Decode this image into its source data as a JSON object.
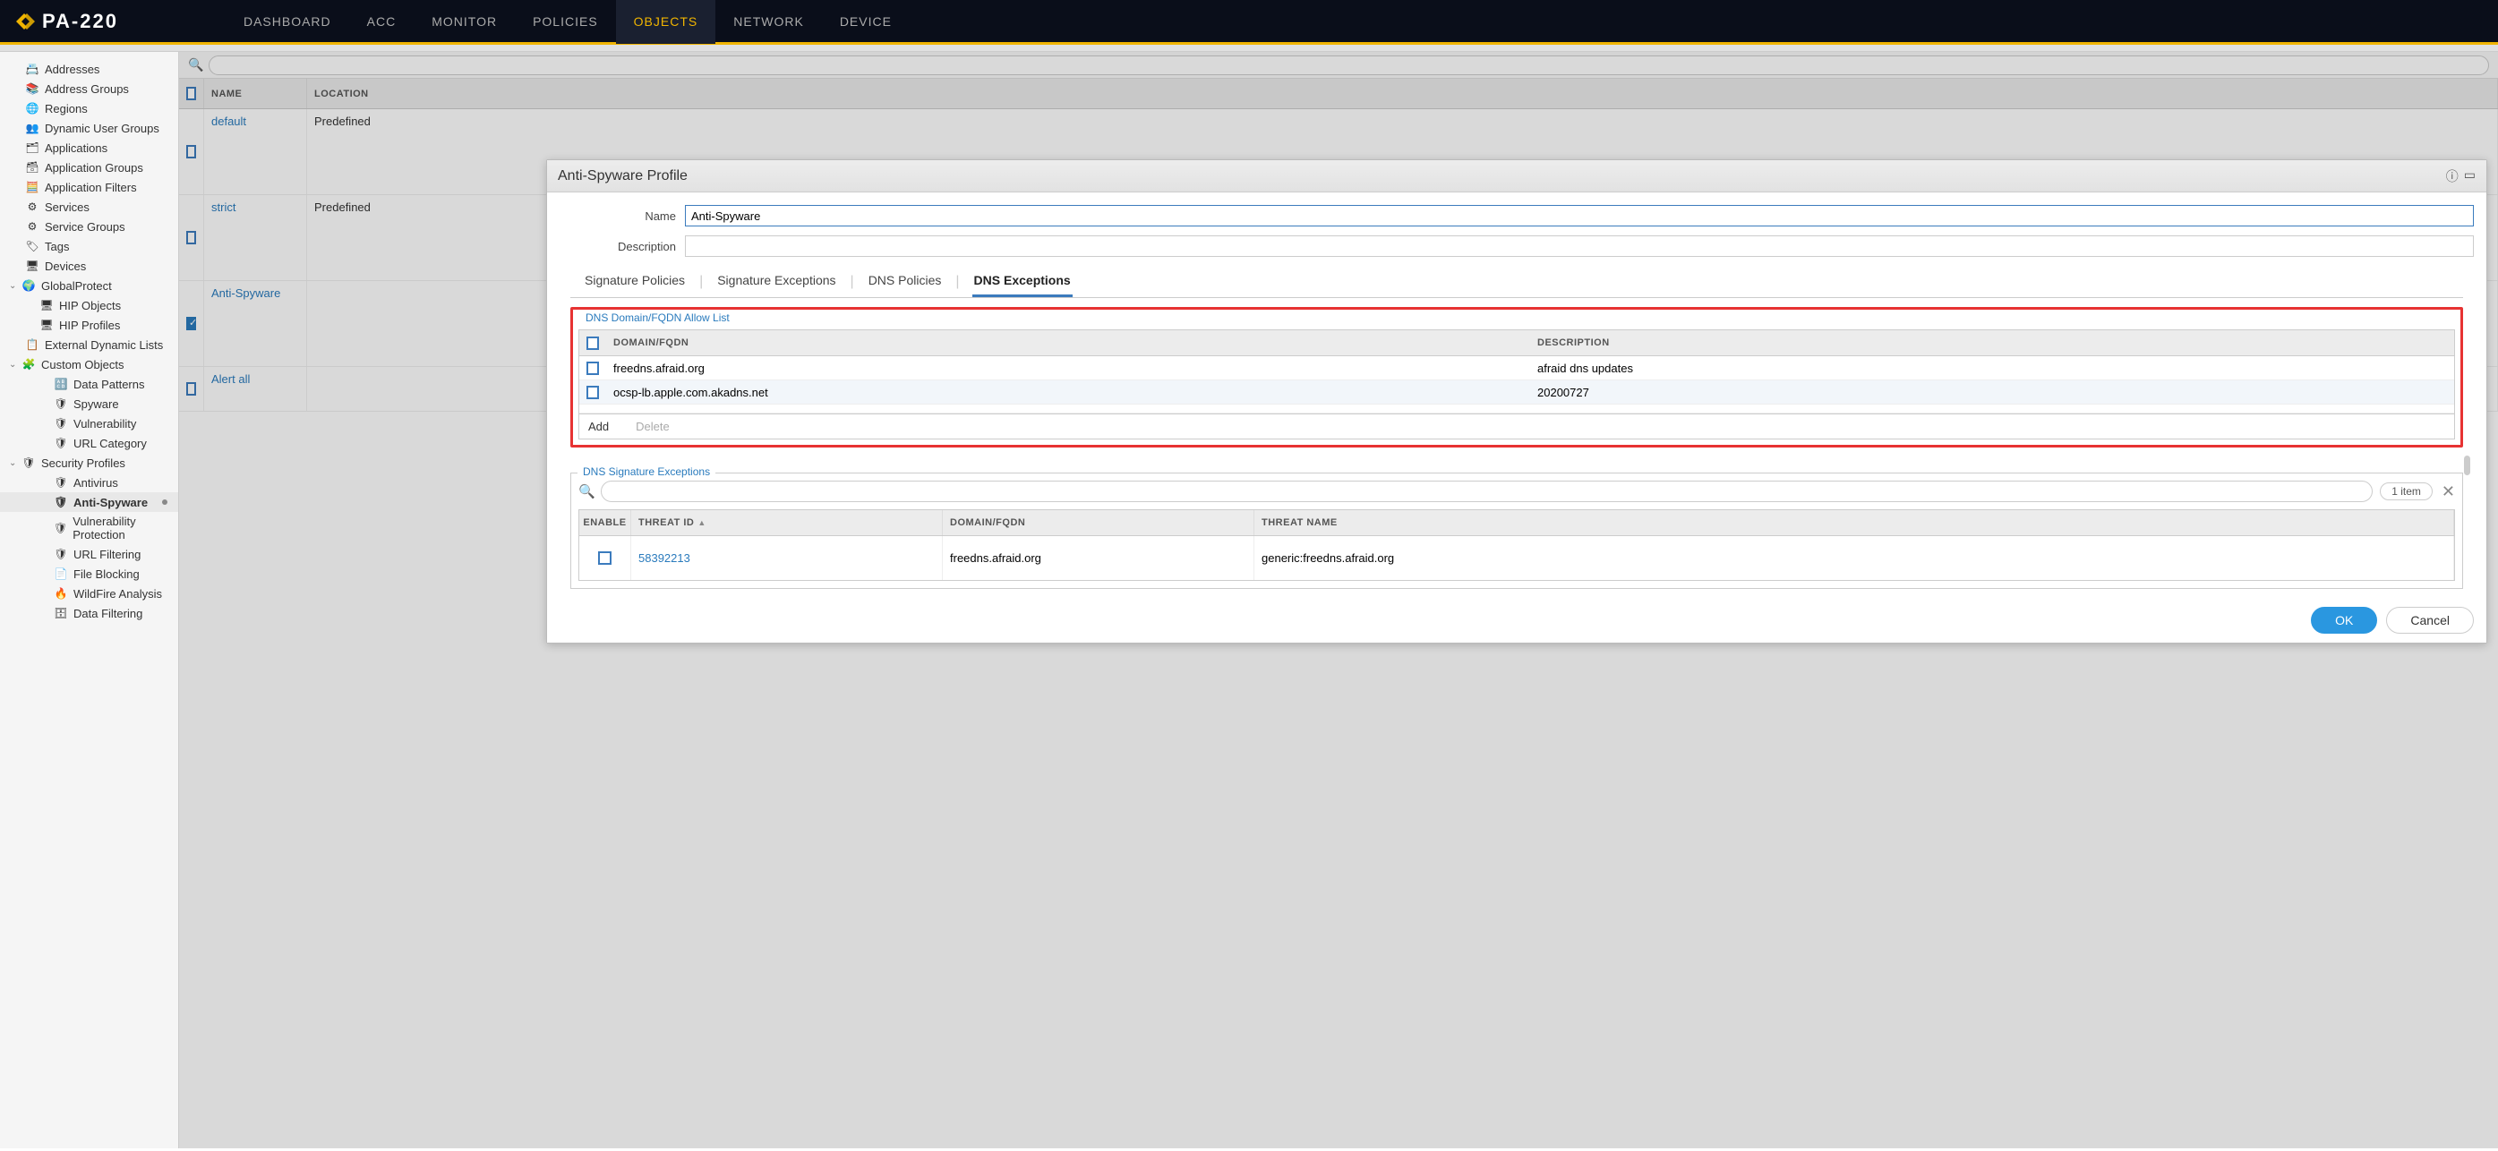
{
  "brand": "PA-220",
  "topnav": [
    "DASHBOARD",
    "ACC",
    "MONITOR",
    "POLICIES",
    "OBJECTS",
    "NETWORK",
    "DEVICE"
  ],
  "topnav_active_index": 4,
  "sidebar": {
    "items": [
      {
        "label": "Addresses",
        "icon": "📇"
      },
      {
        "label": "Address Groups",
        "icon": "📚"
      },
      {
        "label": "Regions",
        "icon": "🌐"
      },
      {
        "label": "Dynamic User Groups",
        "icon": "👥"
      },
      {
        "label": "Applications",
        "icon": "🗂"
      },
      {
        "label": "Application Groups",
        "icon": "🗃"
      },
      {
        "label": "Application Filters",
        "icon": "🧮"
      },
      {
        "label": "Services",
        "icon": "⚙"
      },
      {
        "label": "Service Groups",
        "icon": "⚙"
      },
      {
        "label": "Tags",
        "icon": "🏷"
      },
      {
        "label": "Devices",
        "icon": "🖥"
      }
    ],
    "globalprotect": {
      "label": "GlobalProtect",
      "icon": "🌍",
      "children": [
        {
          "label": "HIP Objects",
          "icon": "🖥"
        },
        {
          "label": "HIP Profiles",
          "icon": "🖥"
        }
      ]
    },
    "edl": {
      "label": "External Dynamic Lists",
      "icon": "📋"
    },
    "custom": {
      "label": "Custom Objects",
      "icon": "🧩",
      "children": [
        {
          "label": "Data Patterns",
          "icon": "🔠"
        },
        {
          "label": "Spyware",
          "icon": "🛡"
        },
        {
          "label": "Vulnerability",
          "icon": "🛡"
        },
        {
          "label": "URL Category",
          "icon": "🛡"
        }
      ]
    },
    "security": {
      "label": "Security Profiles",
      "icon": "🛡",
      "children": [
        {
          "label": "Antivirus",
          "icon": "🛡"
        },
        {
          "label": "Anti-Spyware",
          "icon": "🛡",
          "active": true
        },
        {
          "label": "Vulnerability Protection",
          "icon": "🛡"
        },
        {
          "label": "URL Filtering",
          "icon": "🛡"
        },
        {
          "label": "File Blocking",
          "icon": "📄"
        },
        {
          "label": "WildFire Analysis",
          "icon": "🔥"
        },
        {
          "label": "Data Filtering",
          "icon": "🗄"
        }
      ]
    }
  },
  "grid": {
    "headers": {
      "name": "NAME",
      "location": "LOCATION"
    },
    "rows": [
      {
        "name": "default",
        "location": "Predefined",
        "checked": false,
        "tall": true
      },
      {
        "name": "strict",
        "location": "Predefined",
        "checked": false,
        "tall": true
      },
      {
        "name": "Anti-Spyware",
        "location": "",
        "checked": true,
        "tall": true
      },
      {
        "name": "Alert all",
        "location": "",
        "checked": false,
        "tall": false
      }
    ]
  },
  "modal": {
    "title": "Anti-Spyware Profile",
    "name_label": "Name",
    "desc_label": "Description",
    "name_value": "Anti-Spyware",
    "desc_value": "",
    "tabs": [
      "Signature Policies",
      "Signature Exceptions",
      "DNS Policies",
      "DNS Exceptions"
    ],
    "active_tab_index": 3,
    "allow_list": {
      "title": "DNS Domain/FQDN Allow List",
      "headers": {
        "domain": "DOMAIN/FQDN",
        "desc": "DESCRIPTION"
      },
      "rows": [
        {
          "domain": "freedns.afraid.org",
          "desc": "afraid dns updates"
        },
        {
          "domain": "ocsp-lb.apple.com.akadns.net",
          "desc": "20200727"
        }
      ],
      "add": "Add",
      "delete": "Delete"
    },
    "sig_exceptions": {
      "title": "DNS Signature Exceptions",
      "count": "1 item",
      "headers": {
        "enable": "ENABLE",
        "threat_id": "THREAT ID",
        "domain": "DOMAIN/FQDN",
        "threat_name": "THREAT NAME"
      },
      "rows": [
        {
          "threat_id": "58392213",
          "domain": "freedns.afraid.org",
          "threat_name": "generic:freedns.afraid.org"
        }
      ]
    },
    "ok": "OK",
    "cancel": "Cancel"
  }
}
